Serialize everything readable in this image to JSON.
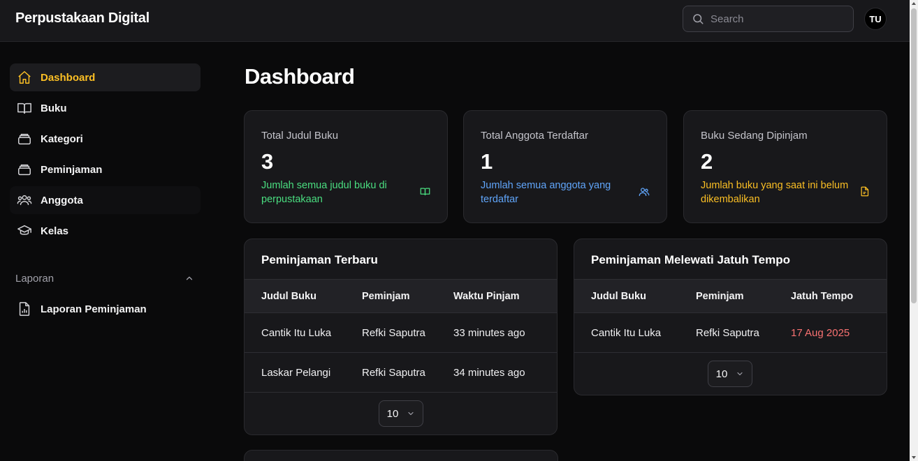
{
  "app": {
    "title": "Perpustakaan Digital"
  },
  "search": {
    "placeholder": "Search"
  },
  "user": {
    "initials": "TU"
  },
  "sidebar": {
    "items": [
      {
        "label": "Dashboard",
        "icon": "home-icon",
        "active": true
      },
      {
        "label": "Buku",
        "icon": "book-open-icon"
      },
      {
        "label": "Kategori",
        "icon": "stack-icon"
      },
      {
        "label": "Peminjaman",
        "icon": "stack-icon"
      },
      {
        "label": "Anggota",
        "icon": "users-icon"
      },
      {
        "label": "Kelas",
        "icon": "graduation-cap-icon"
      }
    ],
    "section": {
      "label": "Laporan",
      "icon": "chevron-up-icon"
    },
    "section_items": [
      {
        "label": "Laporan Peminjaman",
        "icon": "file-chart-icon"
      }
    ]
  },
  "page": {
    "title": "Dashboard"
  },
  "stats": [
    {
      "title": "Total Judul Buku",
      "value": "3",
      "desc": "Jumlah semua judul buku di perpustakaan",
      "color": "#4ade80",
      "icon": "book-open-icon"
    },
    {
      "title": "Total Anggota Terdaftar",
      "value": "1",
      "desc": "Jumlah semua anggota yang terdaftar",
      "color": "#60a5fa",
      "icon": "users-icon"
    },
    {
      "title": "Buku Sedang Dipinjam",
      "value": "2",
      "desc": "Jumlah buku yang saat ini belum dikembalikan",
      "color": "#fbbf24",
      "icon": "file-icon"
    }
  ],
  "recent": {
    "title": "Peminjaman Terbaru",
    "columns": [
      "Judul Buku",
      "Peminjam",
      "Waktu Pinjam"
    ],
    "rows": [
      [
        "Cantik Itu Luka",
        "Refki Saputra",
        "33 minutes ago"
      ],
      [
        "Laskar Pelangi",
        "Refki Saputra",
        "34 minutes ago"
      ]
    ],
    "page_size": "10"
  },
  "overdue": {
    "title": "Peminjaman Melewati Jatuh Tempo",
    "columns": [
      "Judul Buku",
      "Peminjam",
      "Jatuh Tempo"
    ],
    "rows": [
      [
        "Cantik Itu Luka",
        "Refki Saputra",
        "17 Aug 2025"
      ]
    ],
    "page_size": "10"
  },
  "colors": {
    "accent": "#fbbf24",
    "danger": "#f87171",
    "success": "#4ade80",
    "info": "#60a5fa"
  }
}
